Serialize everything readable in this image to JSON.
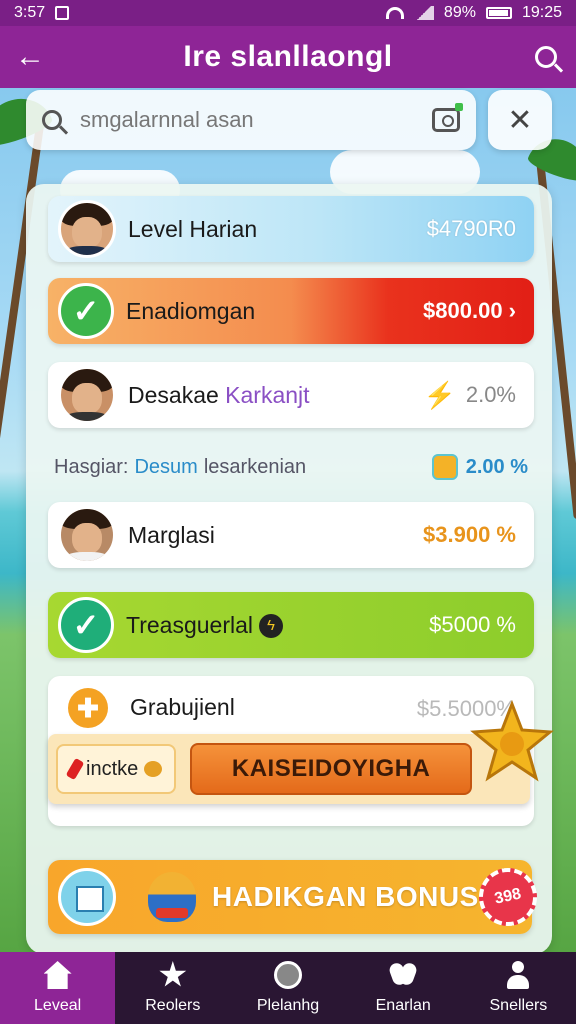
{
  "status_bar": {
    "time_left": "3:57",
    "battery": "89%",
    "time_right": "19:25"
  },
  "app_bar": {
    "title": "Ire slanllaongl"
  },
  "search": {
    "placeholder": "smgalarnnal asan"
  },
  "rows": [
    {
      "name": "Level Harian",
      "amount": "$4790R0"
    },
    {
      "name": "Enadiomgan",
      "amount": "$800.00 ›"
    },
    {
      "name": "Desakae",
      "name_alt": "Karkanjt",
      "amount": "2.0%"
    },
    {
      "name": "Marglasi",
      "amount": "$3.900 %"
    },
    {
      "name": "Treasguerlal",
      "badge": "ϟ",
      "amount": "$5000 %"
    },
    {
      "name": "Grabujienl",
      "amount": "$5.5000%"
    }
  ],
  "info_line": {
    "label": "Hasgiar:",
    "highlight": "Desum",
    "tail": "lesarkenian",
    "percent": "2.00 %"
  },
  "promo": {
    "chip_label": "inctke",
    "button_label": "KAISEIDOYIGHA"
  },
  "bonus": {
    "label": "HADIKGAN BONUS",
    "badge": "398"
  },
  "bottom_nav": [
    {
      "label": "Leveal",
      "icon": "home-icon",
      "active": true
    },
    {
      "label": "Reolers",
      "icon": "star-icon"
    },
    {
      "label": "Plelanhg",
      "icon": "globe-icon"
    },
    {
      "label": "Enarlan",
      "icon": "people-icon"
    },
    {
      "label": "Snellers",
      "icon": "person-icon"
    }
  ],
  "colors": {
    "brand": "#8e2596",
    "status_bar": "#7a1f86",
    "row_orange_red": "#e21f16",
    "row_green": "#8dcd2c",
    "bonus": "#f8a62b"
  }
}
